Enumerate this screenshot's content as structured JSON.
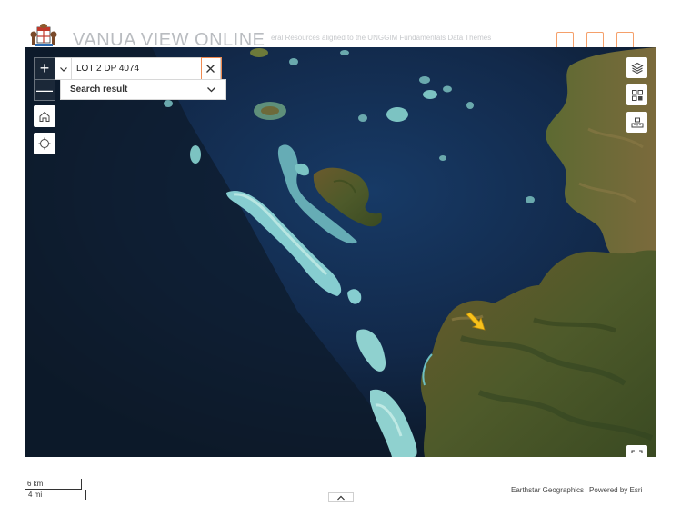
{
  "header": {
    "title": "VANUA VIEW ONLINE",
    "subtitle": "eral Resources aligned to the UNGGIM Fundamentals Data Themes",
    "logo_icon": "fiji-coat-of-arms-icon",
    "buttons": [
      {
        "name": "header-action-1-button"
      },
      {
        "name": "header-action-2-button"
      },
      {
        "name": "header-action-3-button"
      }
    ]
  },
  "search": {
    "value": "LOT 2 DP 4074",
    "result_label": "Search result"
  },
  "map_controls": {
    "zoom_in": "+",
    "zoom_out": "—"
  },
  "footer": {
    "scale_km": "6 km",
    "scale_mi": "4 mi",
    "attribution_source": "Earthstar Geographics",
    "attribution_powered": "Powered by Esri"
  },
  "colors": {
    "accent": "#f08a50",
    "marker": "#f7c21b",
    "ocean_deep": "#0d1a2a",
    "reef": "#7fc6c8"
  }
}
